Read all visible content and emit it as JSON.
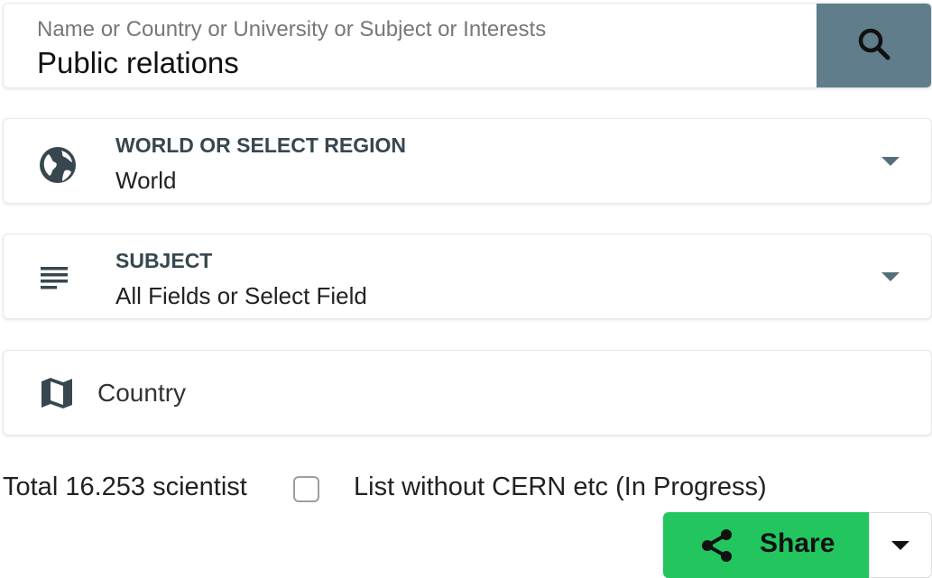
{
  "search": {
    "placeholder": "Name or Country or University or Subject or Interests",
    "value": "Public relations",
    "button_icon": "search-icon"
  },
  "region": {
    "title": "WORLD OR SELECT REGION",
    "value": "World",
    "icon": "globe-icon"
  },
  "subject": {
    "title": "SUBJECT",
    "value": "All Fields or Select Field",
    "icon": "subject-lines-icon"
  },
  "country": {
    "label": "Country",
    "icon": "map-icon"
  },
  "footer": {
    "total": "Total 16.253 scientist",
    "checkbox_label": "List without CERN etc (In Progress)",
    "checkbox_checked": false
  },
  "share": {
    "label": "Share",
    "icon": "share-icon",
    "color": "#22c55e"
  },
  "colors": {
    "search_button": "#607d8b",
    "title_text": "#37474f"
  }
}
